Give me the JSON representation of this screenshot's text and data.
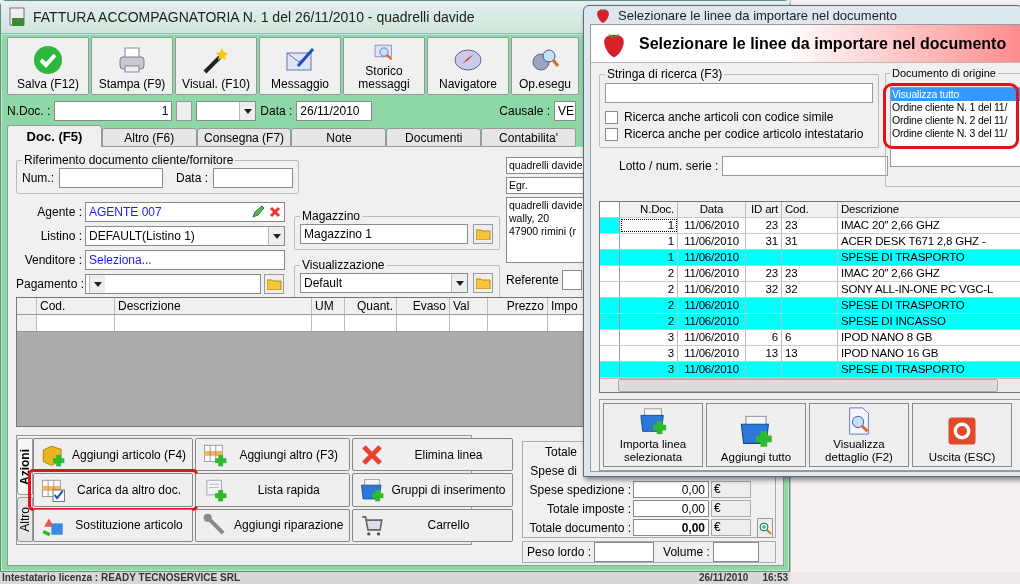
{
  "main_window": {
    "title": "FATTURA ACCOMPAGNATORIA N. 1  del 26/11/2010 - quadrelli davide",
    "toolbar": [
      {
        "label": "Salva (F12)",
        "kind": "save"
      },
      {
        "label": "Stampa (F9)",
        "kind": "print"
      },
      {
        "label": "Visual. (F10)",
        "kind": "preview"
      },
      {
        "label": "Messaggio",
        "kind": "message"
      },
      {
        "label": "Storico messaggi",
        "kind": "history"
      },
      {
        "label": "Navigatore",
        "kind": "navigator"
      },
      {
        "label": "Op.esegu",
        "kind": "operations"
      }
    ],
    "header": {
      "ndoc_label": "N.Doc. :",
      "ndoc_value": "1",
      "date_label": "Data :",
      "date_value": "26/11/2010",
      "causale_label": "Causale :",
      "causale_value": "VE"
    },
    "tabs": [
      {
        "label": "Doc. (F5)",
        "selected": true
      },
      {
        "label": "Altro (F6)",
        "selected": false
      },
      {
        "label": "Consegna (F7)",
        "selected": false
      },
      {
        "label": "Note",
        "selected": false
      },
      {
        "label": "Documenti",
        "selected": false
      },
      {
        "label": "Contabilita'",
        "selected": false
      }
    ],
    "reference": {
      "legend": "Riferimento documento cliente/fornitore",
      "num_label": "Num.:",
      "date_label": "Data :"
    },
    "fields": [
      {
        "label": "Agente :",
        "value": "AGENTE 007",
        "kind": "agent"
      },
      {
        "label": "Listino :",
        "value": "DEFAULT(Listino 1)",
        "kind": "combo"
      },
      {
        "label": "Venditore :",
        "value": "Seleziona...",
        "kind": "link"
      },
      {
        "label": "Pagamento :",
        "kind": "combo-folder"
      }
    ],
    "magazzino": {
      "legend": "Magazzino",
      "value": "Magazzino 1"
    },
    "visualizzazione": {
      "legend": "Visualizzazione",
      "value": "Default"
    },
    "customer": {
      "name": "quadrelli davide",
      "salutation": "Egr.",
      "address": [
        "quadrelli davide",
        "wally, 20",
        "47900 rimini (r"
      ],
      "referente_label": "Referente"
    },
    "lines_table": {
      "columns": [
        "Cod.",
        "Descrizione",
        "UM",
        "Quant.",
        "Evaso",
        "Val",
        "Prezzo",
        "Impo"
      ]
    },
    "action_tabs": [
      {
        "label": "Azioni",
        "selected": true
      },
      {
        "label": "Altro",
        "selected": false
      }
    ],
    "actions": [
      {
        "label": "Aggiungi articolo (F4)",
        "kind": "add-article",
        "highlighted": false
      },
      {
        "label": "Aggiungi altro (F3)",
        "kind": "add-other",
        "highlighted": false
      },
      {
        "label": "Elimina linea",
        "kind": "delete",
        "highlighted": false
      },
      {
        "label": "Carica da altro doc.",
        "kind": "load",
        "highlighted": true
      },
      {
        "label": "Lista rapida",
        "kind": "quick-list",
        "highlighted": false
      },
      {
        "label": "Gruppi di inserimento",
        "kind": "groups",
        "highlighted": false
      },
      {
        "label": "Sostituzione articolo",
        "kind": "replace",
        "highlighted": false
      },
      {
        "label": "Aggiungi riparazione",
        "kind": "repair",
        "highlighted": false
      },
      {
        "label": "Carrello",
        "kind": "cart",
        "highlighted": false
      }
    ],
    "totals": [
      {
        "label": "Totale"
      },
      {
        "label": "Spese di"
      },
      {
        "label": "Spese spedizione :",
        "value": "0,00",
        "currency": "€",
        "bold": false
      },
      {
        "label": "Totale imposte :",
        "value": "0,00",
        "currency": "€",
        "bold": false
      },
      {
        "label": "Totale documento :",
        "value": "0,00",
        "currency": "€",
        "bold": true
      }
    ],
    "weight": {
      "gross_label": "Peso lordo :",
      "volume_label": "Volume :"
    }
  },
  "dialog": {
    "title": "Selezionare le linee da importare nel documento",
    "heading": "Selezionare le linee da importare nel documento",
    "search": {
      "legend": "Stringa di ricerca (F3)",
      "options": [
        {
          "label": "Ricerca anche articoli con codice simile",
          "checked": false
        },
        {
          "label": "Ricerca anche per codice articolo intestatario",
          "checked": false
        }
      ]
    },
    "lot_label": "Lotto / num. serie :",
    "origin": {
      "legend": "Documento di origine",
      "highlighted": true,
      "items": [
        {
          "label": "Visualizza tutto",
          "selected": true
        },
        {
          "label": "Ordine cliente N. 1 del 11/",
          "selected": false
        },
        {
          "label": "Ordine cliente N. 2 del 11/",
          "selected": false
        },
        {
          "label": "Ordine cliente N. 3 del 11/",
          "selected": false
        }
      ]
    },
    "table": {
      "columns": [
        "N.Doc.",
        "Data",
        "ID art",
        "Cod.",
        "Descrizione"
      ],
      "rows": [
        {
          "cells": [
            "1",
            "11/06/2010",
            "23",
            "23",
            "IMAC 20'' 2,66 GHZ"
          ],
          "kind": "article",
          "selected": true
        },
        {
          "cells": [
            "1",
            "11/06/2010",
            "31",
            "31",
            "ACER DESK T671 2,8 GHZ -"
          ],
          "kind": "article",
          "selected": false
        },
        {
          "cells": [
            "1",
            "11/06/2010",
            "",
            "",
            "SPESE DI TRASPORTO"
          ],
          "kind": "expense",
          "selected": false
        },
        {
          "cells": [
            "2",
            "11/06/2010",
            "23",
            "23",
            "IMAC 20'' 2,66 GHZ"
          ],
          "kind": "article",
          "selected": false
        },
        {
          "cells": [
            "2",
            "11/06/2010",
            "32",
            "32",
            "SONY ALL-IN-ONE PC VGC-L"
          ],
          "kind": "article",
          "selected": false
        },
        {
          "cells": [
            "2",
            "11/06/2010",
            "",
            "",
            "SPESE DI TRASPORTO"
          ],
          "kind": "expense",
          "selected": false
        },
        {
          "cells": [
            "2",
            "11/06/2010",
            "",
            "",
            "SPESE DI INCASSO"
          ],
          "kind": "expense",
          "selected": false
        },
        {
          "cells": [
            "3",
            "11/06/2010",
            "6",
            "6",
            "IPOD NANO 8 GB"
          ],
          "kind": "article",
          "selected": false
        },
        {
          "cells": [
            "3",
            "11/06/2010",
            "13",
            "13",
            "IPOD NANO 16 GB"
          ],
          "kind": "article",
          "selected": false
        },
        {
          "cells": [
            "3",
            "11/06/2010",
            "",
            "",
            "SPESE DI TRASPORTO"
          ],
          "kind": "expense",
          "selected": false
        }
      ]
    },
    "buttons": [
      {
        "label": "Importa linea selezionata",
        "kind": "import"
      },
      {
        "label": "Aggiungi tutto",
        "kind": "add-all"
      },
      {
        "label": "Visualizza dettaglio (F2)",
        "kind": "detail"
      },
      {
        "label": "Uscita (ESC)",
        "kind": "exit"
      }
    ]
  },
  "status_bar": {
    "license": "Intestatario licenza : READY TECNOSERVICE SRL",
    "date": "26/11/2010",
    "time": "16:53"
  }
}
